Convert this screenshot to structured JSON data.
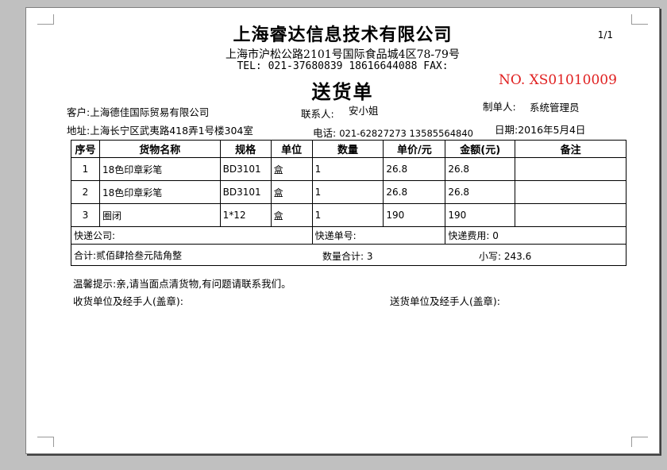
{
  "company": {
    "name": "上海睿达信息技术有限公司",
    "address": "上海市沪松公路2101号国际食品城4区78-79号",
    "tel": "TEL: 021-37680839  18616644088 FAX:"
  },
  "page_number": "1/1",
  "document": {
    "title": "送货单",
    "number": "NO. XS01010009"
  },
  "info": {
    "customer_label": "客户:",
    "customer_value": "上海德佳国际贸易有限公司",
    "contact_label": "联系人:",
    "contact_value": "安小姐",
    "maker_label": "制单人:",
    "maker_value": "系统管理员",
    "address_label": "地址:",
    "address_value": "上海长宁区武夷路418弄1号楼304室",
    "phone_label": "电话:",
    "phone_value": "021-62827273 13585564840",
    "date_label": "日期:",
    "date_value": "2016年5月4日"
  },
  "table": {
    "headers": [
      "序号",
      "货物名称",
      "规格",
      "单位",
      "数量",
      "单价/元",
      "金额(元)",
      "备注"
    ],
    "rows": [
      {
        "no": "1",
        "name": "18色印章彩笔",
        "spec": "BD3101",
        "unit": "盒",
        "qty": "1",
        "price": "26.8",
        "amount": "26.8",
        "remark": ""
      },
      {
        "no": "2",
        "name": "18色印章彩笔",
        "spec": "BD3101",
        "unit": "盒",
        "qty": "1",
        "price": "26.8",
        "amount": "26.8",
        "remark": ""
      },
      {
        "no": "3",
        "name": "圈闭",
        "spec": "1*12",
        "unit": "盒",
        "qty": "1",
        "price": "190",
        "amount": "190",
        "remark": ""
      }
    ],
    "express_company_label": "快递公司:",
    "express_number_label": "快递单号:",
    "express_fee_label": "快递费用:",
    "express_fee_value": "0",
    "total_label": "合计:",
    "total_words": "贰佰肆拾叁元陆角整",
    "qty_total_label": "数量合计:",
    "qty_total_value": "3",
    "small_label": "小写:",
    "small_value": "243.6"
  },
  "notes": {
    "tip": "温馨提示:亲,请当面点清货物,有问题请联系我们。",
    "receiver": "收货单位及经手人(盖章):",
    "sender": "送货单位及经手人(盖章):"
  }
}
